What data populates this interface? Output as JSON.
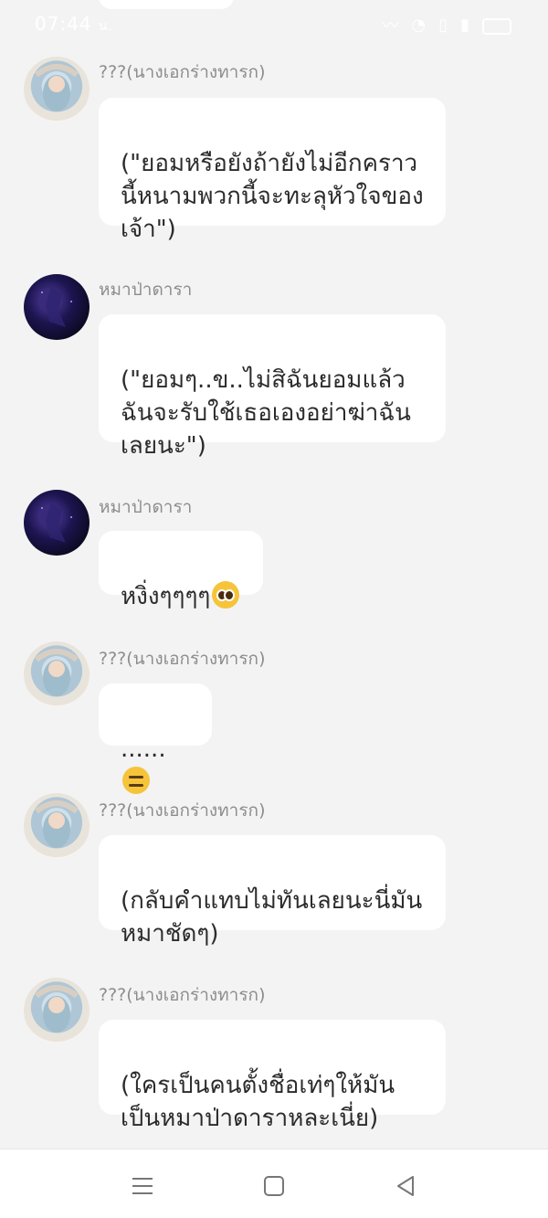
{
  "status_bar": {
    "time": "07:44",
    "carrier_glyph": "น.",
    "icons": [
      "wifi-icon",
      "vibrate-icon",
      "signal-icon",
      "battery-icon"
    ]
  },
  "messages": [
    {
      "sender": "???(นางเอกร่างทารก)",
      "avatar": "baby-avatar",
      "text": "(\"ยอมหรือยังถ้ายังไม่อีกคราว\nนี้หนามพวกนี้จะทะลุหัวใจของ\nเจ้า\")",
      "emoji": ""
    },
    {
      "sender": "หมาป่าดารา",
      "avatar": "dark-avatar",
      "text": "(\"ยอมๆ..ข..ไม่สิฉันยอมแล้ว\nฉันจะรับใช้เธอเองอย่าฆ่าฉัน\nเลยนะ\")",
      "emoji": ""
    },
    {
      "sender": "หมาป่าดารา",
      "avatar": "dark-avatar",
      "text": "หงิ่งๆๆๆๆ",
      "emoji": "pleading-face-emoji"
    },
    {
      "sender": "???(นางเอกร่างทารก)",
      "avatar": "baby-avatar",
      "text": "......",
      "emoji": "expressionless-face-emoji"
    },
    {
      "sender": "???(นางเอกร่างทารก)",
      "avatar": "baby-avatar",
      "text": "(กลับคำแทบไม่ทันเลยนะนี่มัน\nหมาชัดๆ)",
      "emoji": ""
    },
    {
      "sender": "???(นางเอกร่างทารก)",
      "avatar": "baby-avatar",
      "text": "(ใครเป็นคนตั้งชื่อเท่ๆให้มัน\nเป็นหมาป่าดาราหละเนี่ย)",
      "emoji": ""
    }
  ],
  "nav": {
    "buttons": [
      "menu-icon",
      "home-square-icon",
      "back-triangle-icon"
    ]
  }
}
